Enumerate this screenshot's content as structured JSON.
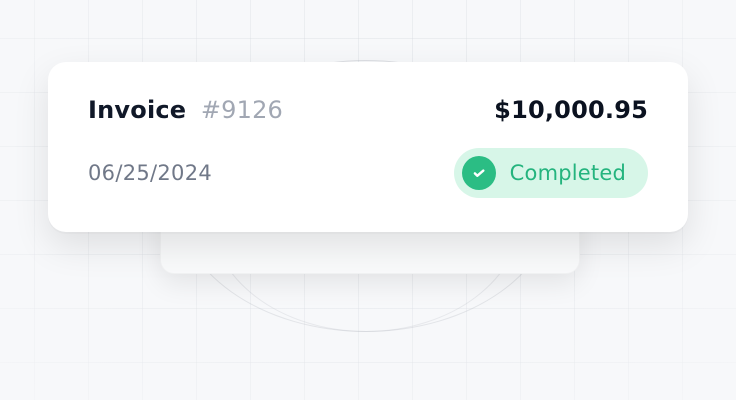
{
  "invoice": {
    "title": "Invoice",
    "number": "#9126",
    "amount": "$10,000.95",
    "date": "06/25/2024",
    "status": {
      "label": "Completed",
      "icon": "check-circle-icon"
    }
  },
  "theme": {
    "success_green": "#2bbd84",
    "success_bg": "#d7f6e8",
    "muted_text": "#707888"
  }
}
